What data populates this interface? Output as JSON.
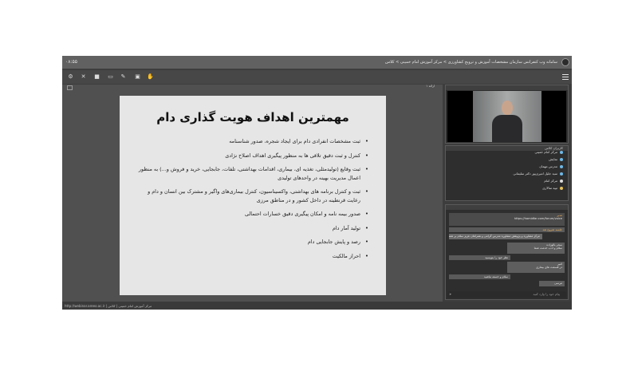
{
  "titlebar": {
    "title": "سامانه وب کنفرانس سازمان مشخصات آموزش و ترویج کشاورزی > مرکز آموزش امام خمینی > کلاس",
    "timer": "۰۸:۵۵"
  },
  "toolbar": {
    "icons": [
      "settings-icon",
      "mic-off-icon",
      "camera-icon",
      "screen-icon",
      "pen-icon",
      "document-icon",
      "hand-icon"
    ]
  },
  "presentation": {
    "label": "ارائه ۱",
    "slide": {
      "title": "مهمترین اهداف هویت گذاری دام",
      "bullets": [
        "ثبت مشخصات انفرادی دام برای ایجاد شجره، صدور شناسنامه",
        "کنترل و ثبت دقیق تلاقی ها به منظور پیگیری اهداف اصلاح نژادی",
        "ثبت وقایع (تولیدمثلی، تغذیه ای، بیماری، اقدامات بهداشتی، تلفات، جابجایی، خرید و فروش و...) به منظور اعمال مدیریت بهینه در واحدهای تولیدی",
        "ثبت و کنترل برنامه های بهداشتی، واکسیناسیون، کنترل بیماری‌های واگیر و مشترک بین انسان و دام و رعایت قرنطینه در داخل کشور و در مناطق مرزی",
        "صدور بیمه نامه و امکان پیگیری دقیق خسارات احتمالی",
        "تولید آمار دام",
        "رصد و پایش جابجایی دام",
        "احراز مالکیت"
      ]
    }
  },
  "status": {
    "text": "http://webinar.areeo.ac.ir  |  مرکز آموزش امام خمینی  |  کلاس"
  },
  "users_panel": {
    "title": "کاربران کلاس",
    "users": [
      {
        "name": "مرکز امام خمینی",
        "icon": "user-icon",
        "color": "#6fb8e6"
      },
      {
        "name": "نمایش",
        "icon": "user-icon",
        "color": "#6fb8e6"
      },
      {
        "name": "مدرس مهمان",
        "icon": "user-icon",
        "color": "#6fb8e6"
      },
      {
        "name": "سید جلیل امیری‌پور دکتر سلیمانی",
        "icon": "user-icon",
        "color": "#6fb8e6"
      },
      {
        "name": "مرکز امام",
        "icon": "user-icon",
        "color": "#dddddd"
      },
      {
        "name": "تیپه سالاری",
        "icon": "user-icon",
        "color": "#e6c25a"
      }
    ]
  },
  "chat": {
    "messages": [
      {
        "author": "مدیر",
        "text": "https://hamidfar.com/forum/voice"
      },
      {
        "author": "مرکز امام",
        "text": "جلسه شروع شد"
      },
      {
        "author": "",
        "text": "مرکز مشاوره و پژوهش مشاوره مدرس گرامی و همراهان عزیز سلام بر شما"
      },
      {
        "author": "سحر بالوزاده",
        "text": "سلام و ادب خدمت شما"
      },
      {
        "author": "",
        "text": "نظر خود را بنویسید"
      },
      {
        "author": "امیر",
        "text": "در قسمت های بیماری"
      },
      {
        "author": "",
        "text": "سلام و خسته نباشید"
      },
      {
        "author": "",
        "text": "مرسی"
      }
    ],
    "input_placeholder": "پیام خود را وارد کنید"
  }
}
